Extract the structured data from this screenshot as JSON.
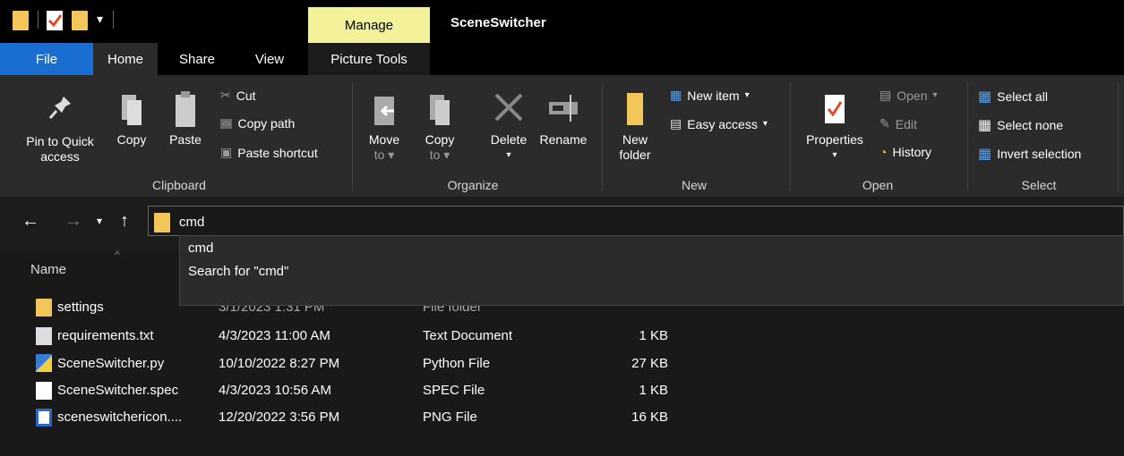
{
  "title_bar": {
    "manage_tab": "Manage",
    "app_title": "SceneSwitcher"
  },
  "tabs": [
    {
      "label": "File"
    },
    {
      "label": "Home"
    },
    {
      "label": "Share"
    },
    {
      "label": "View"
    },
    {
      "label": "Picture Tools"
    }
  ],
  "ribbon": {
    "clipboard": {
      "label": "Clipboard",
      "pin_line1": "Pin to Quick",
      "pin_line2": "access",
      "copy": "Copy",
      "paste": "Paste",
      "cut": "Cut",
      "copy_path": "Copy path",
      "paste_shortcut": "Paste shortcut"
    },
    "organize": {
      "label": "Organize",
      "move_to": "Move",
      "move_to2": "to",
      "copy_to": "Copy",
      "copy_to2": "to",
      "delete": "Delete",
      "rename": "Rename"
    },
    "new": {
      "label": "New",
      "new_folder1": "New",
      "new_folder2": "folder",
      "new_item": "New item",
      "easy_access": "Easy access"
    },
    "open": {
      "label": "Open",
      "properties": "Properties",
      "open": "Open",
      "edit": "Edit",
      "history": "History"
    },
    "select": {
      "label": "Select",
      "select_all": "Select all",
      "select_none": "Select none",
      "invert": "Invert selection"
    }
  },
  "address": {
    "value": "cmd",
    "suggestions": [
      {
        "text": "cmd"
      },
      {
        "text": "Search for \"cmd\""
      }
    ]
  },
  "file_list": {
    "columns": {
      "name": "Name"
    },
    "rows": [
      {
        "name": "settings",
        "date": "3/1/2023 1:31 PM",
        "type": "File folder",
        "size": ""
      },
      {
        "name": "requirements.txt",
        "date": "4/3/2023 11:00 AM",
        "type": "Text Document",
        "size": "1 KB"
      },
      {
        "name": "SceneSwitcher.py",
        "date": "10/10/2022 8:27 PM",
        "type": "Python File",
        "size": "27 KB"
      },
      {
        "name": "SceneSwitcher.spec",
        "date": "4/3/2023 10:56 AM",
        "type": "SPEC File",
        "size": "1 KB"
      },
      {
        "name": "sceneswitchericon....",
        "date": "12/20/2022 3:56 PM",
        "type": "PNG File",
        "size": "16 KB"
      }
    ]
  },
  "colors": {
    "accent": "#1b6ed1",
    "manage": "#f3f29a",
    "folder": "#f4c65a"
  }
}
